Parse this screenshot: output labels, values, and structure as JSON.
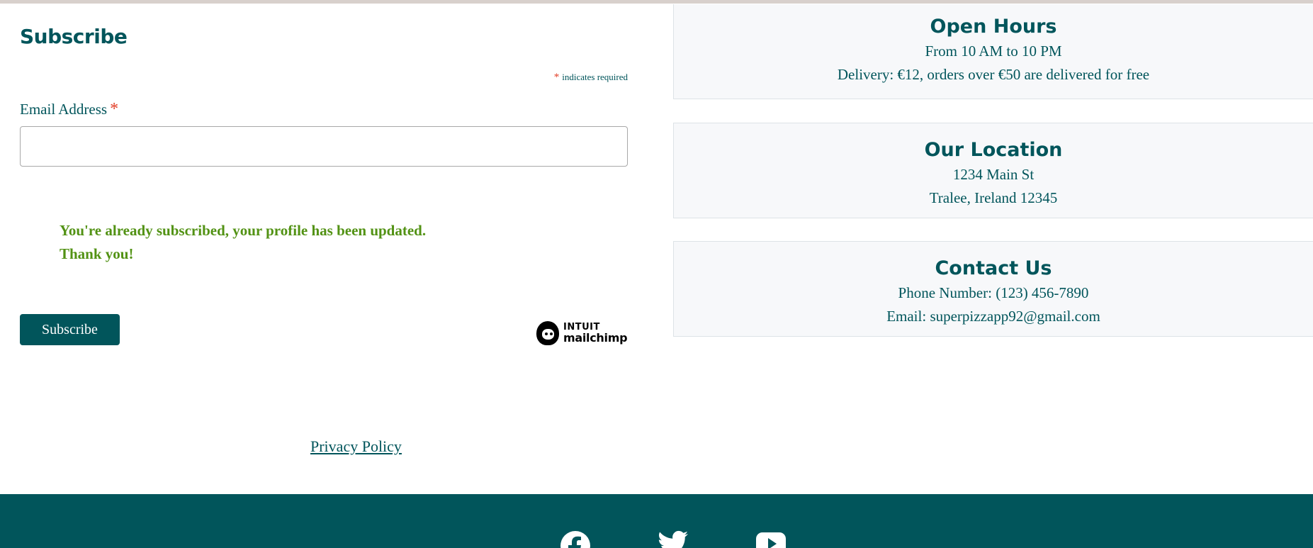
{
  "subscribe": {
    "title": "Subscribe",
    "required_star": "*",
    "required_note": "indicates required",
    "email_label": "Email Address",
    "email_value": "",
    "success_message": "You're already subscribed, your profile has been updated. Thank you!",
    "button_label": "Subscribe",
    "mailchimp_top": "INTUIT",
    "mailchimp_name": "mailchimp"
  },
  "privacy_link": "Privacy Policy",
  "open_hours": {
    "title": "Open Hours",
    "line1": "From 10 AM to 10 PM",
    "line2": "Delivery: €12, orders over €50 are delivered for free"
  },
  "location": {
    "title": "Our Location",
    "line1": "1234 Main St",
    "line2": "Tralee, Ireland 12345"
  },
  "contact": {
    "title": "Contact Us",
    "phone": "Phone Number: (123) 456-7890",
    "email": "Email: superpizzapp92@gmail.com"
  },
  "footer": {
    "social": [
      "facebook-icon",
      "twitter-icon",
      "youtube-icon"
    ]
  },
  "colors": {
    "primary": "#01555b",
    "required": "#e23f28",
    "success": "#529214",
    "box_background": "#f7f8fa"
  }
}
